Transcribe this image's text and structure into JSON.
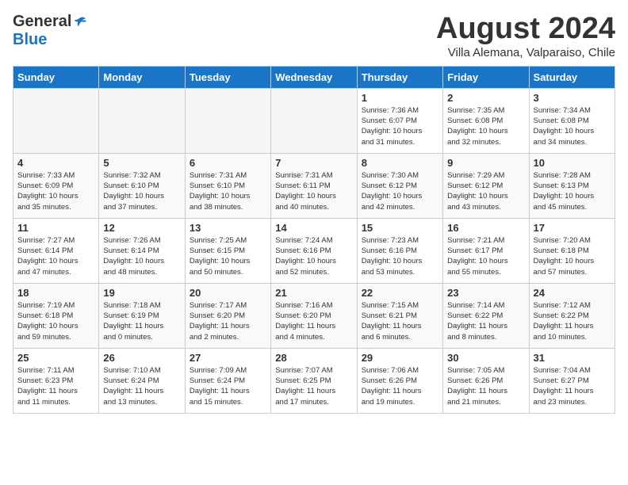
{
  "header": {
    "logo_general": "General",
    "logo_blue": "Blue",
    "title": "August 2024",
    "subtitle": "Villa Alemana, Valparaiso, Chile"
  },
  "days_of_week": [
    "Sunday",
    "Monday",
    "Tuesday",
    "Wednesday",
    "Thursday",
    "Friday",
    "Saturday"
  ],
  "weeks": [
    [
      {
        "day": "",
        "info": "",
        "empty": true
      },
      {
        "day": "",
        "info": "",
        "empty": true
      },
      {
        "day": "",
        "info": "",
        "empty": true
      },
      {
        "day": "",
        "info": "",
        "empty": true
      },
      {
        "day": "1",
        "info": "Sunrise: 7:36 AM\nSunset: 6:07 PM\nDaylight: 10 hours\nand 31 minutes.",
        "empty": false
      },
      {
        "day": "2",
        "info": "Sunrise: 7:35 AM\nSunset: 6:08 PM\nDaylight: 10 hours\nand 32 minutes.",
        "empty": false
      },
      {
        "day": "3",
        "info": "Sunrise: 7:34 AM\nSunset: 6:08 PM\nDaylight: 10 hours\nand 34 minutes.",
        "empty": false
      }
    ],
    [
      {
        "day": "4",
        "info": "Sunrise: 7:33 AM\nSunset: 6:09 PM\nDaylight: 10 hours\nand 35 minutes.",
        "empty": false
      },
      {
        "day": "5",
        "info": "Sunrise: 7:32 AM\nSunset: 6:10 PM\nDaylight: 10 hours\nand 37 minutes.",
        "empty": false
      },
      {
        "day": "6",
        "info": "Sunrise: 7:31 AM\nSunset: 6:10 PM\nDaylight: 10 hours\nand 38 minutes.",
        "empty": false
      },
      {
        "day": "7",
        "info": "Sunrise: 7:31 AM\nSunset: 6:11 PM\nDaylight: 10 hours\nand 40 minutes.",
        "empty": false
      },
      {
        "day": "8",
        "info": "Sunrise: 7:30 AM\nSunset: 6:12 PM\nDaylight: 10 hours\nand 42 minutes.",
        "empty": false
      },
      {
        "day": "9",
        "info": "Sunrise: 7:29 AM\nSunset: 6:12 PM\nDaylight: 10 hours\nand 43 minutes.",
        "empty": false
      },
      {
        "day": "10",
        "info": "Sunrise: 7:28 AM\nSunset: 6:13 PM\nDaylight: 10 hours\nand 45 minutes.",
        "empty": false
      }
    ],
    [
      {
        "day": "11",
        "info": "Sunrise: 7:27 AM\nSunset: 6:14 PM\nDaylight: 10 hours\nand 47 minutes.",
        "empty": false
      },
      {
        "day": "12",
        "info": "Sunrise: 7:26 AM\nSunset: 6:14 PM\nDaylight: 10 hours\nand 48 minutes.",
        "empty": false
      },
      {
        "day": "13",
        "info": "Sunrise: 7:25 AM\nSunset: 6:15 PM\nDaylight: 10 hours\nand 50 minutes.",
        "empty": false
      },
      {
        "day": "14",
        "info": "Sunrise: 7:24 AM\nSunset: 6:16 PM\nDaylight: 10 hours\nand 52 minutes.",
        "empty": false
      },
      {
        "day": "15",
        "info": "Sunrise: 7:23 AM\nSunset: 6:16 PM\nDaylight: 10 hours\nand 53 minutes.",
        "empty": false
      },
      {
        "day": "16",
        "info": "Sunrise: 7:21 AM\nSunset: 6:17 PM\nDaylight: 10 hours\nand 55 minutes.",
        "empty": false
      },
      {
        "day": "17",
        "info": "Sunrise: 7:20 AM\nSunset: 6:18 PM\nDaylight: 10 hours\nand 57 minutes.",
        "empty": false
      }
    ],
    [
      {
        "day": "18",
        "info": "Sunrise: 7:19 AM\nSunset: 6:18 PM\nDaylight: 10 hours\nand 59 minutes.",
        "empty": false
      },
      {
        "day": "19",
        "info": "Sunrise: 7:18 AM\nSunset: 6:19 PM\nDaylight: 11 hours\nand 0 minutes.",
        "empty": false
      },
      {
        "day": "20",
        "info": "Sunrise: 7:17 AM\nSunset: 6:20 PM\nDaylight: 11 hours\nand 2 minutes.",
        "empty": false
      },
      {
        "day": "21",
        "info": "Sunrise: 7:16 AM\nSunset: 6:20 PM\nDaylight: 11 hours\nand 4 minutes.",
        "empty": false
      },
      {
        "day": "22",
        "info": "Sunrise: 7:15 AM\nSunset: 6:21 PM\nDaylight: 11 hours\nand 6 minutes.",
        "empty": false
      },
      {
        "day": "23",
        "info": "Sunrise: 7:14 AM\nSunset: 6:22 PM\nDaylight: 11 hours\nand 8 minutes.",
        "empty": false
      },
      {
        "day": "24",
        "info": "Sunrise: 7:12 AM\nSunset: 6:22 PM\nDaylight: 11 hours\nand 10 minutes.",
        "empty": false
      }
    ],
    [
      {
        "day": "25",
        "info": "Sunrise: 7:11 AM\nSunset: 6:23 PM\nDaylight: 11 hours\nand 11 minutes.",
        "empty": false
      },
      {
        "day": "26",
        "info": "Sunrise: 7:10 AM\nSunset: 6:24 PM\nDaylight: 11 hours\nand 13 minutes.",
        "empty": false
      },
      {
        "day": "27",
        "info": "Sunrise: 7:09 AM\nSunset: 6:24 PM\nDaylight: 11 hours\nand 15 minutes.",
        "empty": false
      },
      {
        "day": "28",
        "info": "Sunrise: 7:07 AM\nSunset: 6:25 PM\nDaylight: 11 hours\nand 17 minutes.",
        "empty": false
      },
      {
        "day": "29",
        "info": "Sunrise: 7:06 AM\nSunset: 6:26 PM\nDaylight: 11 hours\nand 19 minutes.",
        "empty": false
      },
      {
        "day": "30",
        "info": "Sunrise: 7:05 AM\nSunset: 6:26 PM\nDaylight: 11 hours\nand 21 minutes.",
        "empty": false
      },
      {
        "day": "31",
        "info": "Sunrise: 7:04 AM\nSunset: 6:27 PM\nDaylight: 11 hours\nand 23 minutes.",
        "empty": false
      }
    ]
  ]
}
